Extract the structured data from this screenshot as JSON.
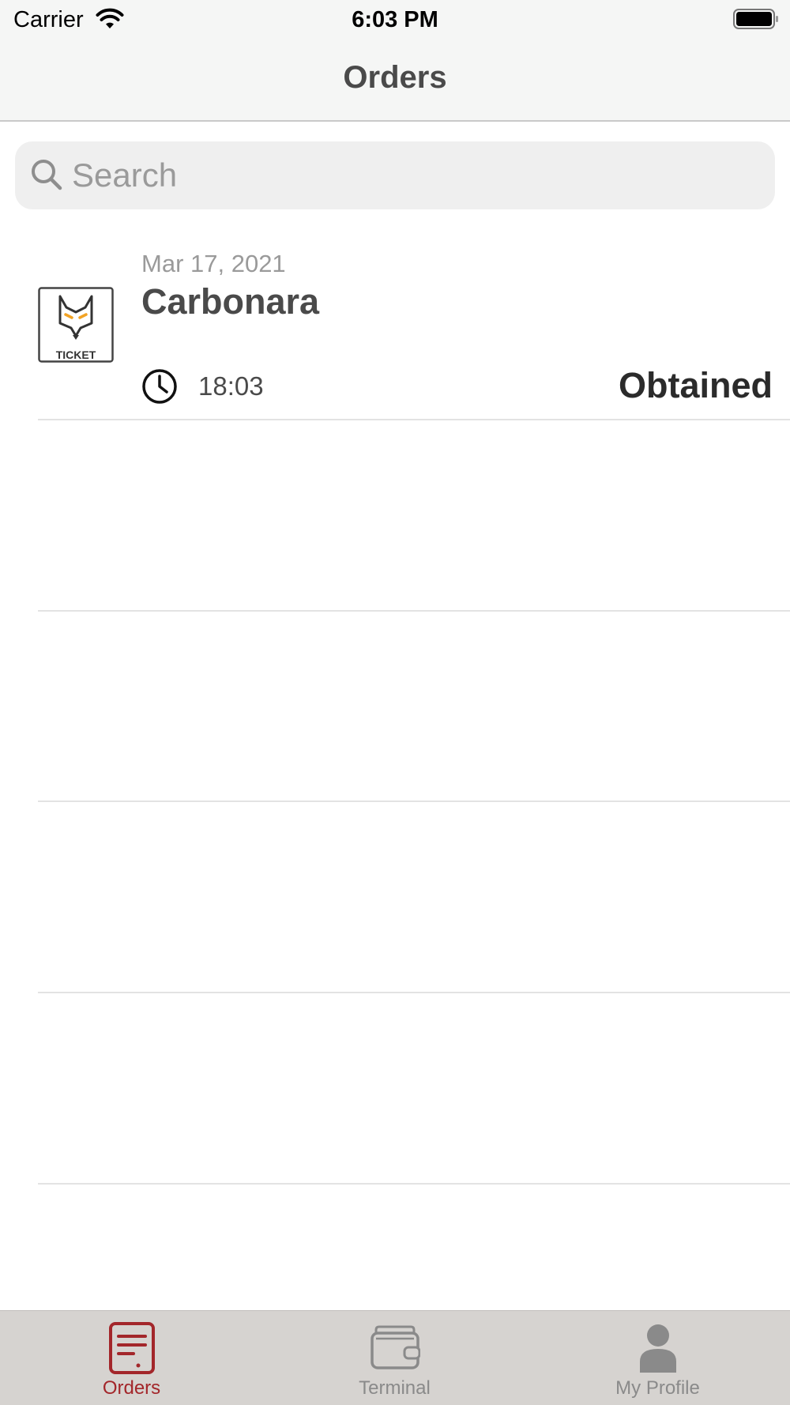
{
  "status_bar": {
    "carrier": "Carrier",
    "time": "6:03 PM"
  },
  "nav": {
    "title": "Orders"
  },
  "search": {
    "placeholder": "Search",
    "value": ""
  },
  "orders": [
    {
      "date": "Mar 17, 2021",
      "name": "Carbonara",
      "time": "18:03",
      "status": "Obtained",
      "logo_text": "TICKET"
    }
  ],
  "tabs": [
    {
      "label": "Orders",
      "icon": "orders-icon",
      "active": true
    },
    {
      "label": "Terminal",
      "icon": "wallet-icon",
      "active": false
    },
    {
      "label": "My Profile",
      "icon": "profile-icon",
      "active": false
    }
  ],
  "colors": {
    "accent": "#a3262a",
    "tab_bar_bg": "#d6d3d0",
    "nav_bg": "#f5f6f5",
    "logo_orange": "#f2a324"
  }
}
